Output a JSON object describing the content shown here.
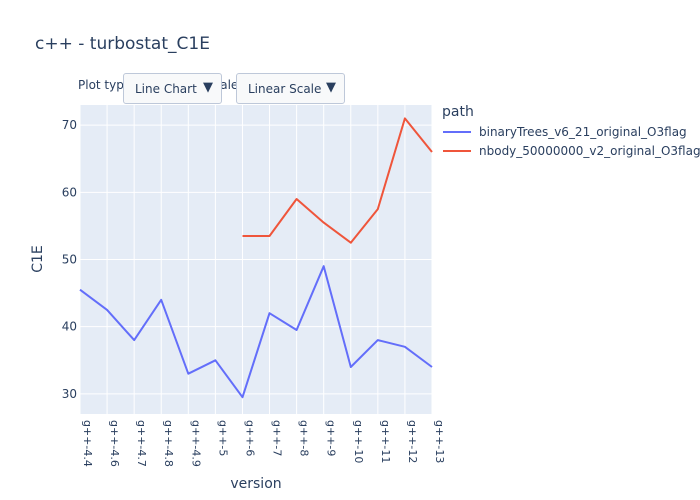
{
  "controls": {
    "plot_type_label": "Plot type",
    "scale_label": "Scale:",
    "plot_type_value": "Line Chart",
    "scale_value": "Linear Scale",
    "dropdown_arrow_icon": "triangle-down-icon"
  },
  "legend": {
    "title": "path"
  },
  "chart_data": {
    "type": "line",
    "title": "c++ - turbostat_C1E",
    "xlabel": "version",
    "ylabel": "C1E",
    "categories": [
      "g++-4.4",
      "g++-4.6",
      "g++-4.7",
      "g++-4.8",
      "g++-4.9",
      "g++-5",
      "g++-6",
      "g++-7",
      "g++-8",
      "g++-9",
      "g++-10",
      "g++-11",
      "g++-12",
      "g++-13"
    ],
    "ylim": [
      27,
      73
    ],
    "yticks": [
      30,
      40,
      50,
      60,
      70
    ],
    "grid": true,
    "legend_position": "right",
    "series": [
      {
        "name": "binaryTrees_v6_21_original_O3flag",
        "color": "#636efa",
        "values": [
          45.5,
          42.5,
          38,
          44,
          33,
          35,
          29.5,
          42,
          39.5,
          49,
          34,
          38,
          37,
          34
        ]
      },
      {
        "name": "nbody_50000000_v2_original_O3flag",
        "color": "#ef553b",
        "values": [
          null,
          null,
          null,
          null,
          null,
          null,
          53.5,
          53.5,
          59,
          55.5,
          52.5,
          57.5,
          71,
          66
        ]
      }
    ]
  }
}
